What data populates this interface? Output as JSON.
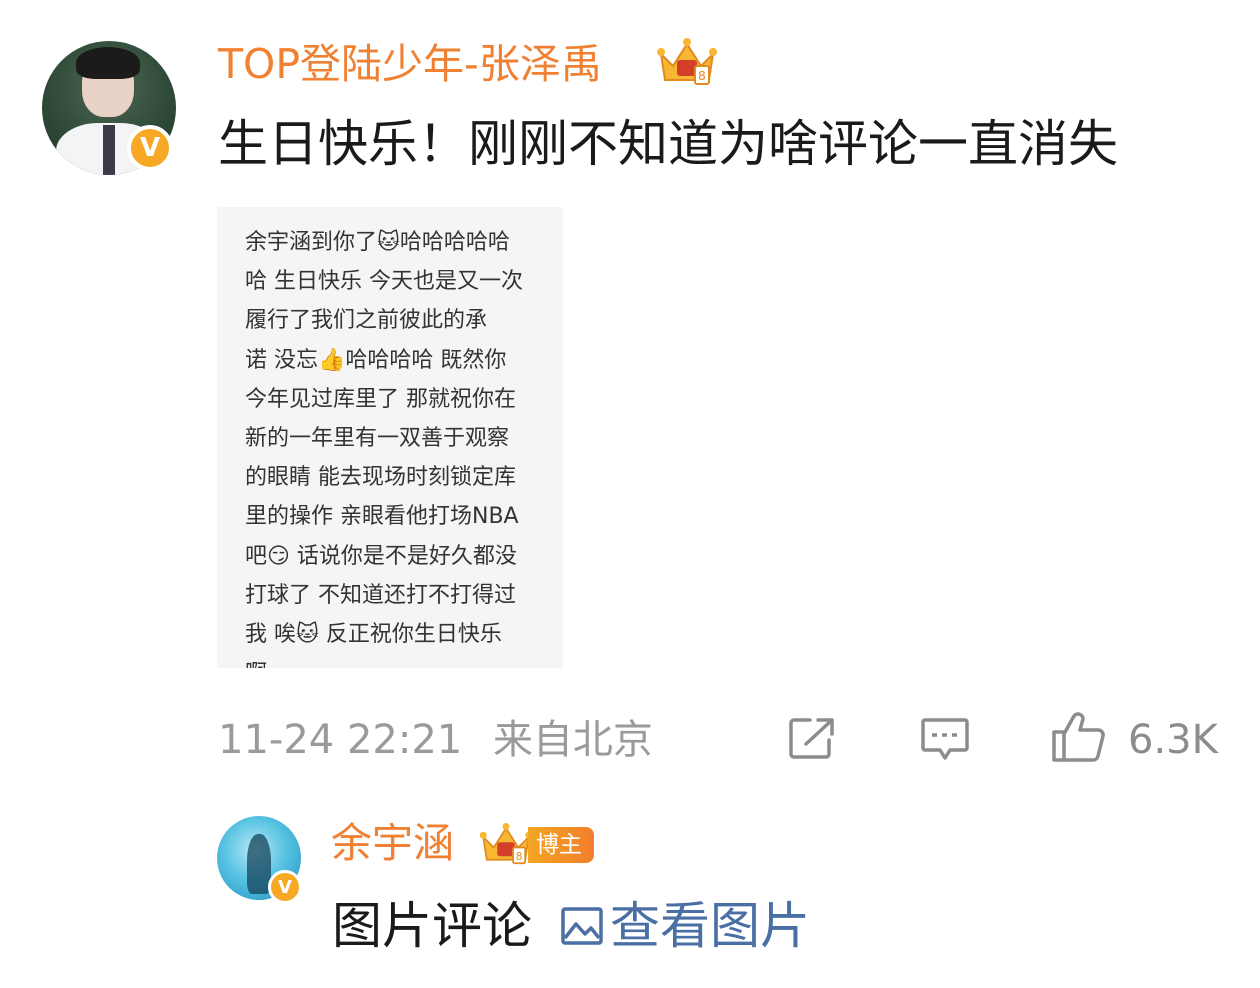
{
  "comment": {
    "username": "TOP登陆少年-张泽禹",
    "text": "生日快乐！刚刚不知道为啥评论一直消失",
    "attachment_lines": [
      "余宇涵到你了🐱哈哈哈哈哈",
      "哈 生日快乐 今天也是又一次",
      "履行了我们之前彼此的承",
      "诺 没忘👍哈哈哈哈 既然你",
      "今年见过库里了 那就祝你在",
      "新的一年里有一双善于观察",
      "的眼睛 能去现场时刻锁定库",
      "里的操作 亲眼看他打场NBA",
      "吧😏 话说你是不是好久都没",
      "打球了 不知道还打不打得过",
      "我 唉🐱 反正祝你生日快乐",
      "啊"
    ],
    "time": "11-24 22:21",
    "location": "来自北京",
    "likes": "6.3K"
  },
  "reply": {
    "username": "余宇涵",
    "badge": "博主",
    "text": "图片评论",
    "link": "查看图片"
  },
  "colors": {
    "username": "#f08133",
    "link": "#4a6fa5",
    "meta": "#9a9a9a",
    "verified": "#f7a825"
  }
}
